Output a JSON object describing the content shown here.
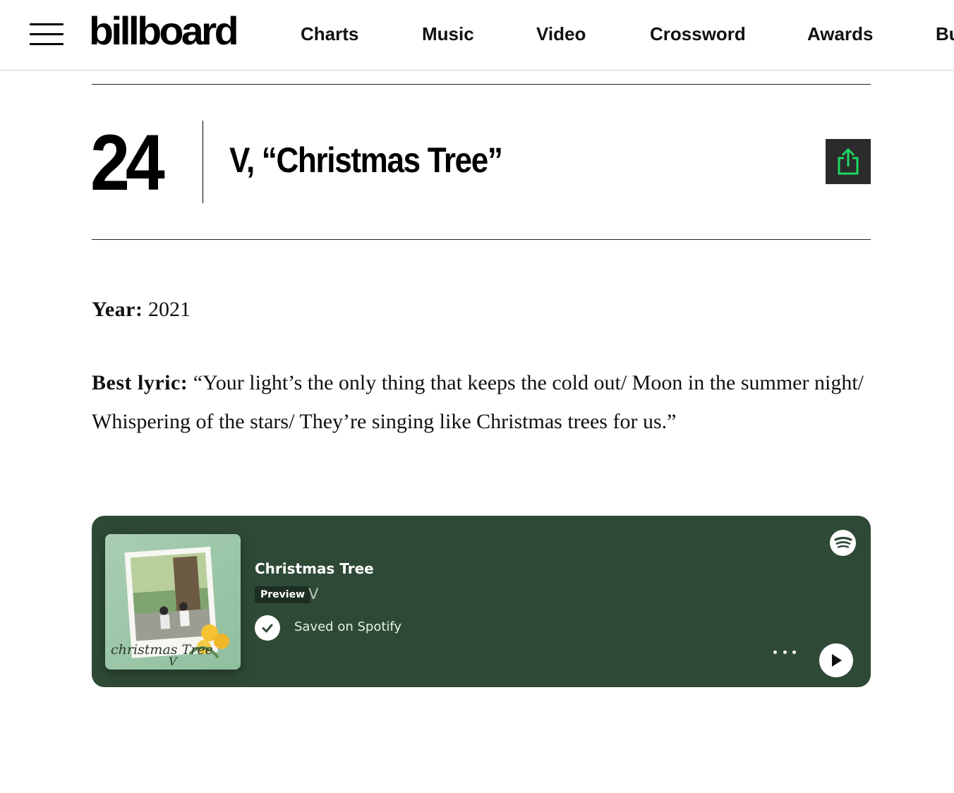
{
  "header": {
    "logo": "billboard",
    "nav": [
      "Charts",
      "Music",
      "Video",
      "Crossword",
      "Awards",
      "Bu"
    ]
  },
  "entry": {
    "rank": "24",
    "title": "V, “Christmas Tree”",
    "year_label": "Year:",
    "year": "2021",
    "lyric_label": "Best lyric:",
    "lyric": "“Your light’s the only thing that keeps the cold out/ Moon in the summer night/ Whispering of the stars/ They’re singing like Christmas trees for us.”"
  },
  "spotify": {
    "track": "Christmas Tree",
    "badge": "Preview",
    "artist": "V",
    "saved": "Saved on Spotify",
    "cover_text": "christmas Tree",
    "cover_artist_sign": "V",
    "colors": {
      "card": "#2e4a36",
      "accent": "#1ed760",
      "share_bg": "#2b2b2b"
    }
  }
}
